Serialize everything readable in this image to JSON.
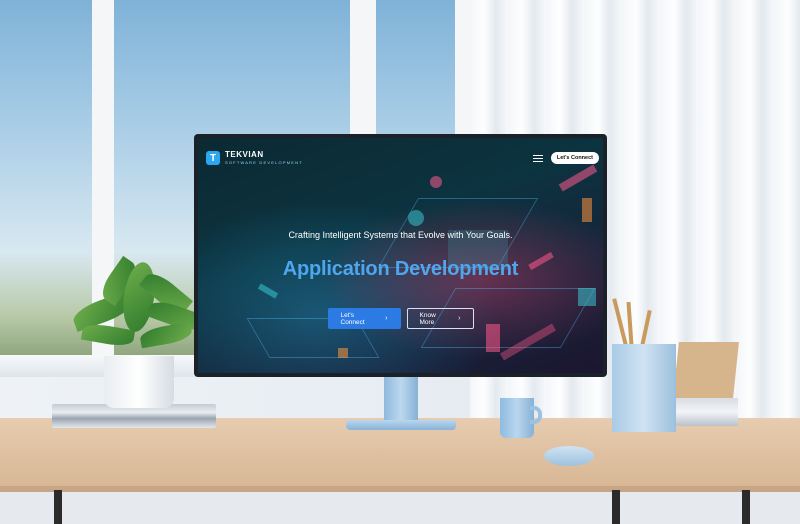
{
  "site": {
    "logo_letter": "T",
    "brand_name": "TEKVIAN",
    "brand_subtitle": "SOFTWARE DEVELOPMENT",
    "nav_cta_label": "Let's Connect"
  },
  "hero": {
    "tagline": "Crafting Intelligent Systems that Evolve with Your Goals.",
    "title": "Application Development",
    "primary_button_label": "Let's Connect",
    "secondary_button_label": "Know More",
    "chevron_glyph": "›"
  },
  "colors": {
    "accent_blue": "#4ea6ee",
    "button_blue": "#2c7be5",
    "logo_blue": "#2aa7ef",
    "screen_bg": "#0c3340"
  },
  "icons": {
    "logo": "tekvian-logo-icon",
    "menu": "hamburger-menu-icon",
    "chevron": "chevron-right-icon"
  }
}
